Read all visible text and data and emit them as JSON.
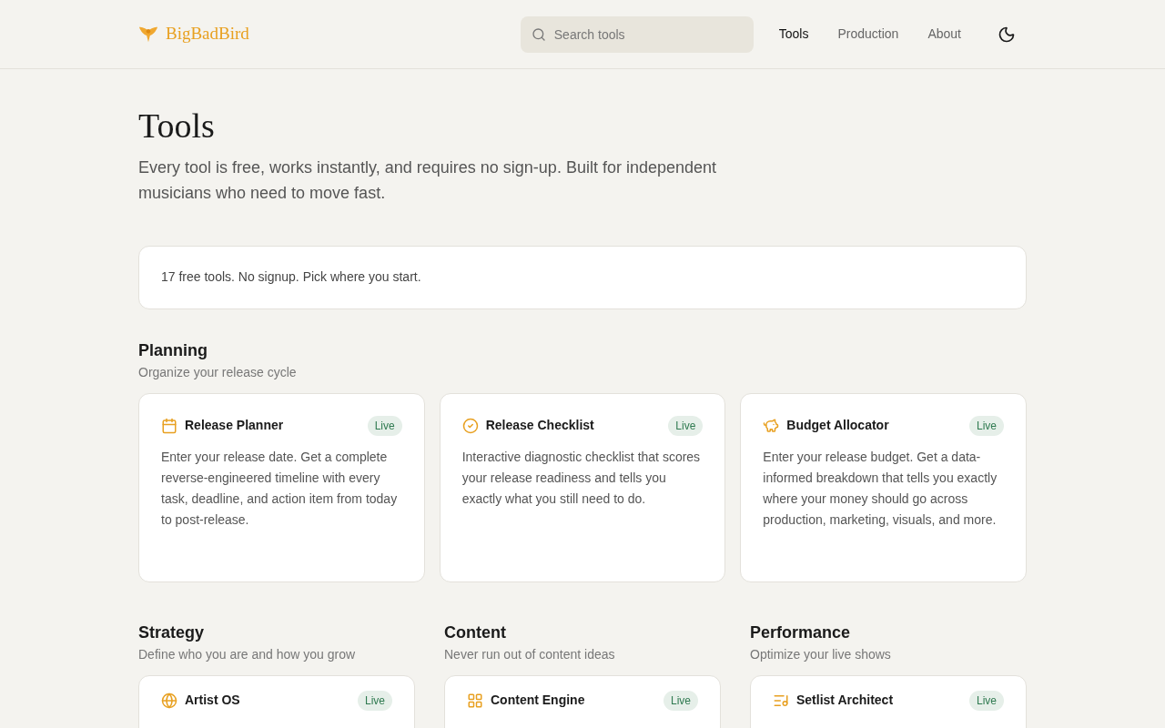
{
  "header": {
    "logo": "BigBadBird",
    "search": {
      "placeholder": "Search tools"
    },
    "nav": [
      {
        "label": "Tools",
        "selected": true
      },
      {
        "label": "Production",
        "selected": false
      },
      {
        "label": "About",
        "selected": false
      }
    ]
  },
  "page": {
    "title": "Tools",
    "subtitle": "Every tool is free, works instantly, and requires no sign-up. Built for independent musicians who need to move fast.",
    "notice": "17 free tools. No signup. Pick where you start."
  },
  "planning": {
    "title": "Planning",
    "subtitle": "Organize your release cycle",
    "tools": [
      {
        "name": "Release Planner",
        "badge": "Live",
        "description": "Enter your release date. Get a complete reverse-engineered timeline with every task, deadline, and action item from today to post-release."
      },
      {
        "name": "Release Checklist",
        "badge": "Live",
        "description": "Interactive diagnostic checklist that scores your release readiness and tells you exactly what you still need to do."
      },
      {
        "name": "Budget Allocator",
        "badge": "Live",
        "description": "Enter your release budget. Get a data-informed breakdown that tells you exactly where your money should go across production, marketing, visuals, and more."
      }
    ]
  },
  "categories": [
    {
      "title": "Strategy",
      "subtitle": "Define who you are and how you grow",
      "tools": [
        {
          "name": "Artist OS",
          "badge": "Live"
        }
      ]
    },
    {
      "title": "Content",
      "subtitle": "Never run out of content ideas",
      "tools": [
        {
          "name": "Content Engine",
          "badge": "Live"
        }
      ]
    },
    {
      "title": "Performance",
      "subtitle": "Optimize your live shows",
      "tools": [
        {
          "name": "Setlist Architect",
          "badge": "Live"
        }
      ]
    }
  ]
}
